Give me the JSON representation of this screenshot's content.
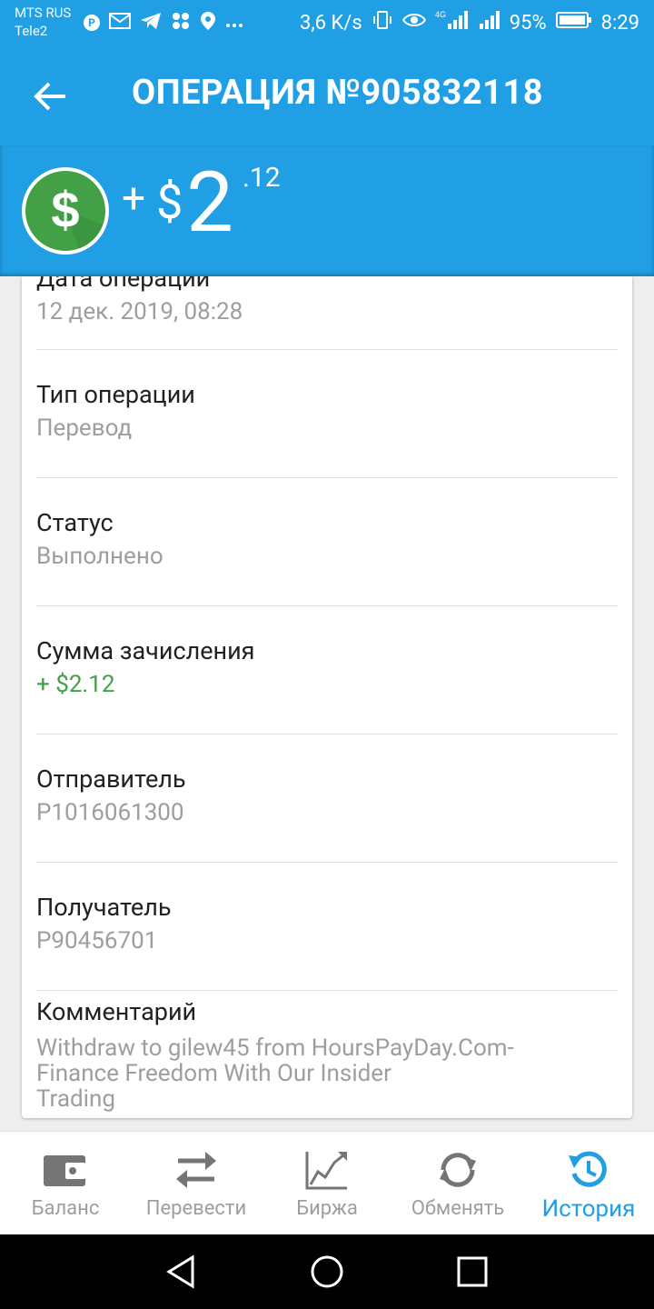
{
  "status_bar": {
    "carrier_1": "MTS RUS",
    "carrier_2": "Tele2",
    "network_speed": "3,6 K/s",
    "battery_percent": "95%",
    "time": "8:29",
    "icons_left": [
      "p-badge-icon",
      "mail-icon",
      "telegram-icon",
      "dots-cluster-icon",
      "location-icon",
      "more-icon"
    ],
    "icons_right": [
      "vibrate-icon",
      "eye-icon",
      "signal-4g-icon",
      "signal-icon",
      "battery-icon"
    ]
  },
  "app_bar": {
    "title": "ОПЕРАЦИЯ №905832118"
  },
  "amount_header": {
    "sign": "+",
    "currency": "$",
    "whole": "2",
    "cents": ".12"
  },
  "details": {
    "date_label": "Дата операции",
    "date_value": "12 дек. 2019, 08:28",
    "type_label": "Тип операции",
    "type_value": "Перевод",
    "status_label": "Статус",
    "status_value": "Выполнено",
    "credit_label": "Сумма зачисления",
    "credit_value": "+ $2.12",
    "sender_label": "Отправитель",
    "sender_value": "P1016061300",
    "recipient_label": "Получатель",
    "recipient_value": "P90456701",
    "comment_label": "Комментарий",
    "comment_line_1": "Withdraw to gilew45 from HoursPayDay.Com-",
    "comment_line_2": "Finance Freedom With Our Insider",
    "comment_line_3": "Trading"
  },
  "bottom_nav": {
    "items": [
      {
        "label": "Баланс",
        "icon": "wallet-icon"
      },
      {
        "label": "Перевести",
        "icon": "transfer-arrows-icon"
      },
      {
        "label": "Биржа",
        "icon": "chart-icon"
      },
      {
        "label": "Обменять",
        "icon": "exchange-icon"
      },
      {
        "label": "История",
        "icon": "history-icon"
      }
    ],
    "active": "История"
  },
  "colors": {
    "primary": "#209fe4",
    "green": "#43a047",
    "text_primary": "#212121",
    "text_secondary": "#9e9e9e"
  }
}
